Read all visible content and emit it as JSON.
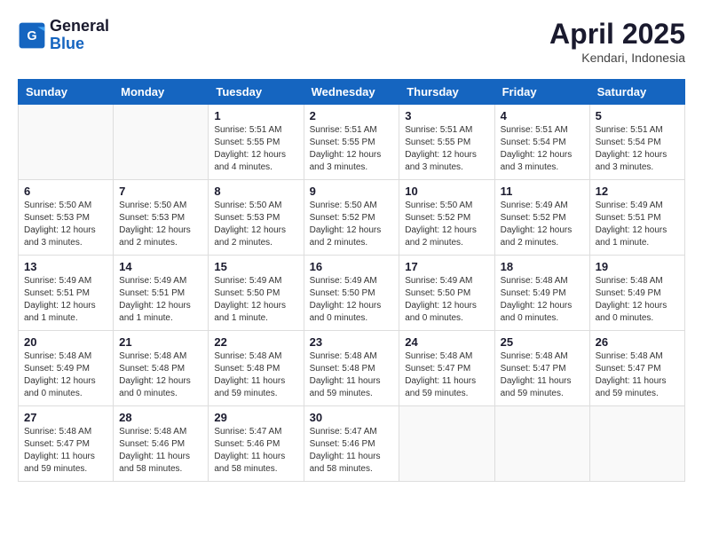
{
  "logo": {
    "text_general": "General",
    "text_blue": "Blue"
  },
  "header": {
    "month_year": "April 2025",
    "location": "Kendari, Indonesia"
  },
  "weekdays": [
    "Sunday",
    "Monday",
    "Tuesday",
    "Wednesday",
    "Thursday",
    "Friday",
    "Saturday"
  ],
  "weeks": [
    [
      {
        "day": "",
        "info": ""
      },
      {
        "day": "",
        "info": ""
      },
      {
        "day": "1",
        "info": "Sunrise: 5:51 AM\nSunset: 5:55 PM\nDaylight: 12 hours\nand 4 minutes."
      },
      {
        "day": "2",
        "info": "Sunrise: 5:51 AM\nSunset: 5:55 PM\nDaylight: 12 hours\nand 3 minutes."
      },
      {
        "day": "3",
        "info": "Sunrise: 5:51 AM\nSunset: 5:55 PM\nDaylight: 12 hours\nand 3 minutes."
      },
      {
        "day": "4",
        "info": "Sunrise: 5:51 AM\nSunset: 5:54 PM\nDaylight: 12 hours\nand 3 minutes."
      },
      {
        "day": "5",
        "info": "Sunrise: 5:51 AM\nSunset: 5:54 PM\nDaylight: 12 hours\nand 3 minutes."
      }
    ],
    [
      {
        "day": "6",
        "info": "Sunrise: 5:50 AM\nSunset: 5:53 PM\nDaylight: 12 hours\nand 3 minutes."
      },
      {
        "day": "7",
        "info": "Sunrise: 5:50 AM\nSunset: 5:53 PM\nDaylight: 12 hours\nand 2 minutes."
      },
      {
        "day": "8",
        "info": "Sunrise: 5:50 AM\nSunset: 5:53 PM\nDaylight: 12 hours\nand 2 minutes."
      },
      {
        "day": "9",
        "info": "Sunrise: 5:50 AM\nSunset: 5:52 PM\nDaylight: 12 hours\nand 2 minutes."
      },
      {
        "day": "10",
        "info": "Sunrise: 5:50 AM\nSunset: 5:52 PM\nDaylight: 12 hours\nand 2 minutes."
      },
      {
        "day": "11",
        "info": "Sunrise: 5:49 AM\nSunset: 5:52 PM\nDaylight: 12 hours\nand 2 minutes."
      },
      {
        "day": "12",
        "info": "Sunrise: 5:49 AM\nSunset: 5:51 PM\nDaylight: 12 hours\nand 1 minute."
      }
    ],
    [
      {
        "day": "13",
        "info": "Sunrise: 5:49 AM\nSunset: 5:51 PM\nDaylight: 12 hours\nand 1 minute."
      },
      {
        "day": "14",
        "info": "Sunrise: 5:49 AM\nSunset: 5:51 PM\nDaylight: 12 hours\nand 1 minute."
      },
      {
        "day": "15",
        "info": "Sunrise: 5:49 AM\nSunset: 5:50 PM\nDaylight: 12 hours\nand 1 minute."
      },
      {
        "day": "16",
        "info": "Sunrise: 5:49 AM\nSunset: 5:50 PM\nDaylight: 12 hours\nand 0 minutes."
      },
      {
        "day": "17",
        "info": "Sunrise: 5:49 AM\nSunset: 5:50 PM\nDaylight: 12 hours\nand 0 minutes."
      },
      {
        "day": "18",
        "info": "Sunrise: 5:48 AM\nSunset: 5:49 PM\nDaylight: 12 hours\nand 0 minutes."
      },
      {
        "day": "19",
        "info": "Sunrise: 5:48 AM\nSunset: 5:49 PM\nDaylight: 12 hours\nand 0 minutes."
      }
    ],
    [
      {
        "day": "20",
        "info": "Sunrise: 5:48 AM\nSunset: 5:49 PM\nDaylight: 12 hours\nand 0 minutes."
      },
      {
        "day": "21",
        "info": "Sunrise: 5:48 AM\nSunset: 5:48 PM\nDaylight: 12 hours\nand 0 minutes."
      },
      {
        "day": "22",
        "info": "Sunrise: 5:48 AM\nSunset: 5:48 PM\nDaylight: 11 hours\nand 59 minutes."
      },
      {
        "day": "23",
        "info": "Sunrise: 5:48 AM\nSunset: 5:48 PM\nDaylight: 11 hours\nand 59 minutes."
      },
      {
        "day": "24",
        "info": "Sunrise: 5:48 AM\nSunset: 5:47 PM\nDaylight: 11 hours\nand 59 minutes."
      },
      {
        "day": "25",
        "info": "Sunrise: 5:48 AM\nSunset: 5:47 PM\nDaylight: 11 hours\nand 59 minutes."
      },
      {
        "day": "26",
        "info": "Sunrise: 5:48 AM\nSunset: 5:47 PM\nDaylight: 11 hours\nand 59 minutes."
      }
    ],
    [
      {
        "day": "27",
        "info": "Sunrise: 5:48 AM\nSunset: 5:47 PM\nDaylight: 11 hours\nand 59 minutes."
      },
      {
        "day": "28",
        "info": "Sunrise: 5:48 AM\nSunset: 5:46 PM\nDaylight: 11 hours\nand 58 minutes."
      },
      {
        "day": "29",
        "info": "Sunrise: 5:47 AM\nSunset: 5:46 PM\nDaylight: 11 hours\nand 58 minutes."
      },
      {
        "day": "30",
        "info": "Sunrise: 5:47 AM\nSunset: 5:46 PM\nDaylight: 11 hours\nand 58 minutes."
      },
      {
        "day": "",
        "info": ""
      },
      {
        "day": "",
        "info": ""
      },
      {
        "day": "",
        "info": ""
      }
    ]
  ]
}
